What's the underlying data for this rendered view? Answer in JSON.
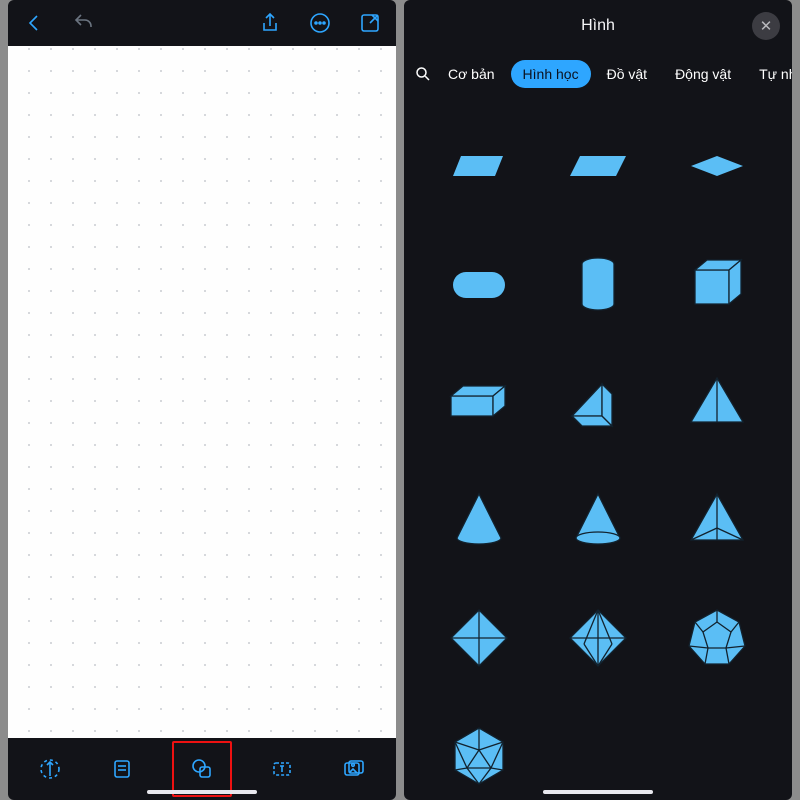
{
  "colors": {
    "accent": "#2ea6ff",
    "shape": "#5bbef5",
    "bg_dark": "#121318"
  },
  "left_screen": {
    "top_icons": {
      "back": "back-icon",
      "undo": "undo-icon",
      "share": "share-icon",
      "more": "more-icon",
      "compose": "compose-icon"
    },
    "bottom_icons": {
      "pen": "pen-tool-icon",
      "note": "note-tool-icon",
      "shapes": "shapes-tool-icon",
      "text": "text-tool-icon",
      "image": "image-tool-icon"
    },
    "highlighted_tool": "shapes"
  },
  "right_screen": {
    "panel_title": "Hình",
    "close_label": "✕",
    "tabs": [
      {
        "id": "basic",
        "label": "Cơ bản",
        "active": false
      },
      {
        "id": "geom",
        "label": "Hình học",
        "active": true
      },
      {
        "id": "objects",
        "label": "Đồ vật",
        "active": false
      },
      {
        "id": "animals",
        "label": "Động vật",
        "active": false
      },
      {
        "id": "nature",
        "label": "Tự nhiên",
        "active": false
      }
    ],
    "shapes": [
      "trapezoid",
      "parallelogram",
      "rhombus",
      "rounded-rectangle",
      "cylinder",
      "cube",
      "rectangular-prism",
      "triangular-prism",
      "pyramid",
      "cone-solid",
      "cone-wireframe",
      "tetrahedron",
      "octahedron-top",
      "octahedron",
      "dodecahedron",
      "icosahedron"
    ]
  }
}
